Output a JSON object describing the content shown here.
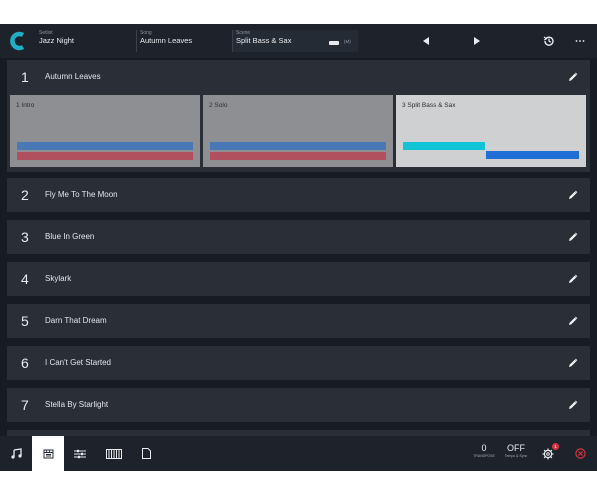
{
  "topbar": {
    "setlist_label": "Setlist",
    "setlist_value": "Jazz Night",
    "song_label": "Song",
    "song_value": "Autumn Leaves",
    "scene_label": "Scene",
    "scene_value": "Split Bass & Sax",
    "scene_toggle_label": "(M)",
    "icons": [
      "logo-icon",
      "previous-icon",
      "next-icon",
      "history-icon",
      "more-icon"
    ]
  },
  "songs": [
    {
      "number": "1",
      "title": "Autumn Leaves",
      "expanded": true
    },
    {
      "number": "2",
      "title": "Fly Me To The Moon"
    },
    {
      "number": "3",
      "title": "Blue In Green"
    },
    {
      "number": "4",
      "title": "Skylark"
    },
    {
      "number": "5",
      "title": "Darn That Dream"
    },
    {
      "number": "6",
      "title": "I Can't Get Started"
    },
    {
      "number": "7",
      "title": "Stella By Starlight"
    }
  ],
  "scenes": [
    {
      "label": "1  Intro",
      "selected": false
    },
    {
      "label": "2  Solo",
      "selected": false
    },
    {
      "label": "3  Split Bass & Sax",
      "selected": true
    }
  ],
  "bottombar": {
    "transpose_value": "0",
    "transpose_label": "TRANSPOSE",
    "tempo_value": "OFF",
    "tempo_label": "Tempo & Sync",
    "settings_badge": "1",
    "icons": [
      "music-note-icon",
      "scenes-icon",
      "mixer-icon",
      "keyboard-icon",
      "document-icon",
      "settings-icon",
      "panic-icon"
    ]
  },
  "colors": {
    "background": "#171b22",
    "row": "#2a2f37",
    "scene_card": "#8d8f92",
    "scene_card_selected": "#cfd0d2",
    "layer_blue": "#4a78b5",
    "layer_red": "#b0505e",
    "layer_cyan": "#12c3d6",
    "layer_royal": "#1f6fd6"
  }
}
